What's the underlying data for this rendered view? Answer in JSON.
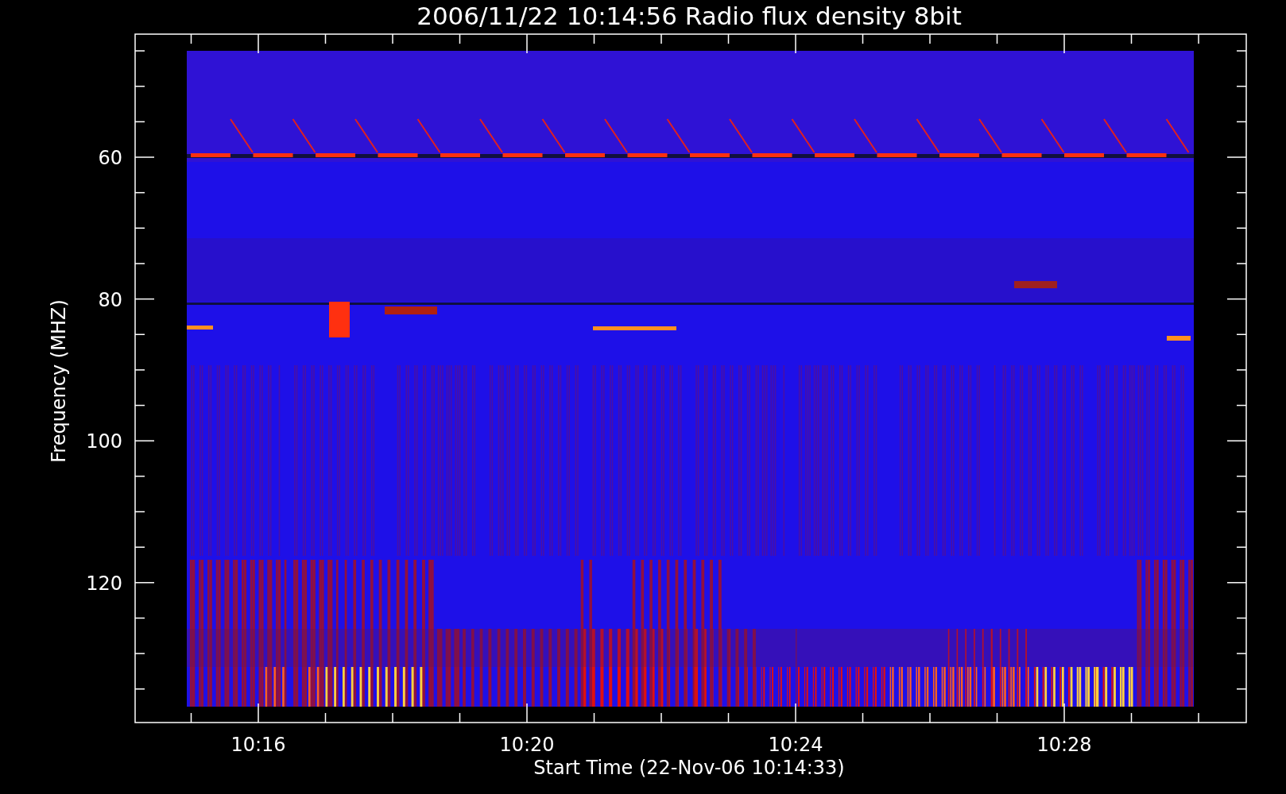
{
  "title": "2006/11/22 10:14:56 Radio flux density 8bit",
  "ylabel": "Frequency (MHZ)",
  "xlabel": "Start Time (22-Nov-06 10:14:33)",
  "y_ticks": [
    "60",
    "80",
    "100",
    "120"
  ],
  "x_ticks": [
    "10:16",
    "10:20",
    "10:24",
    "10:28"
  ]
}
